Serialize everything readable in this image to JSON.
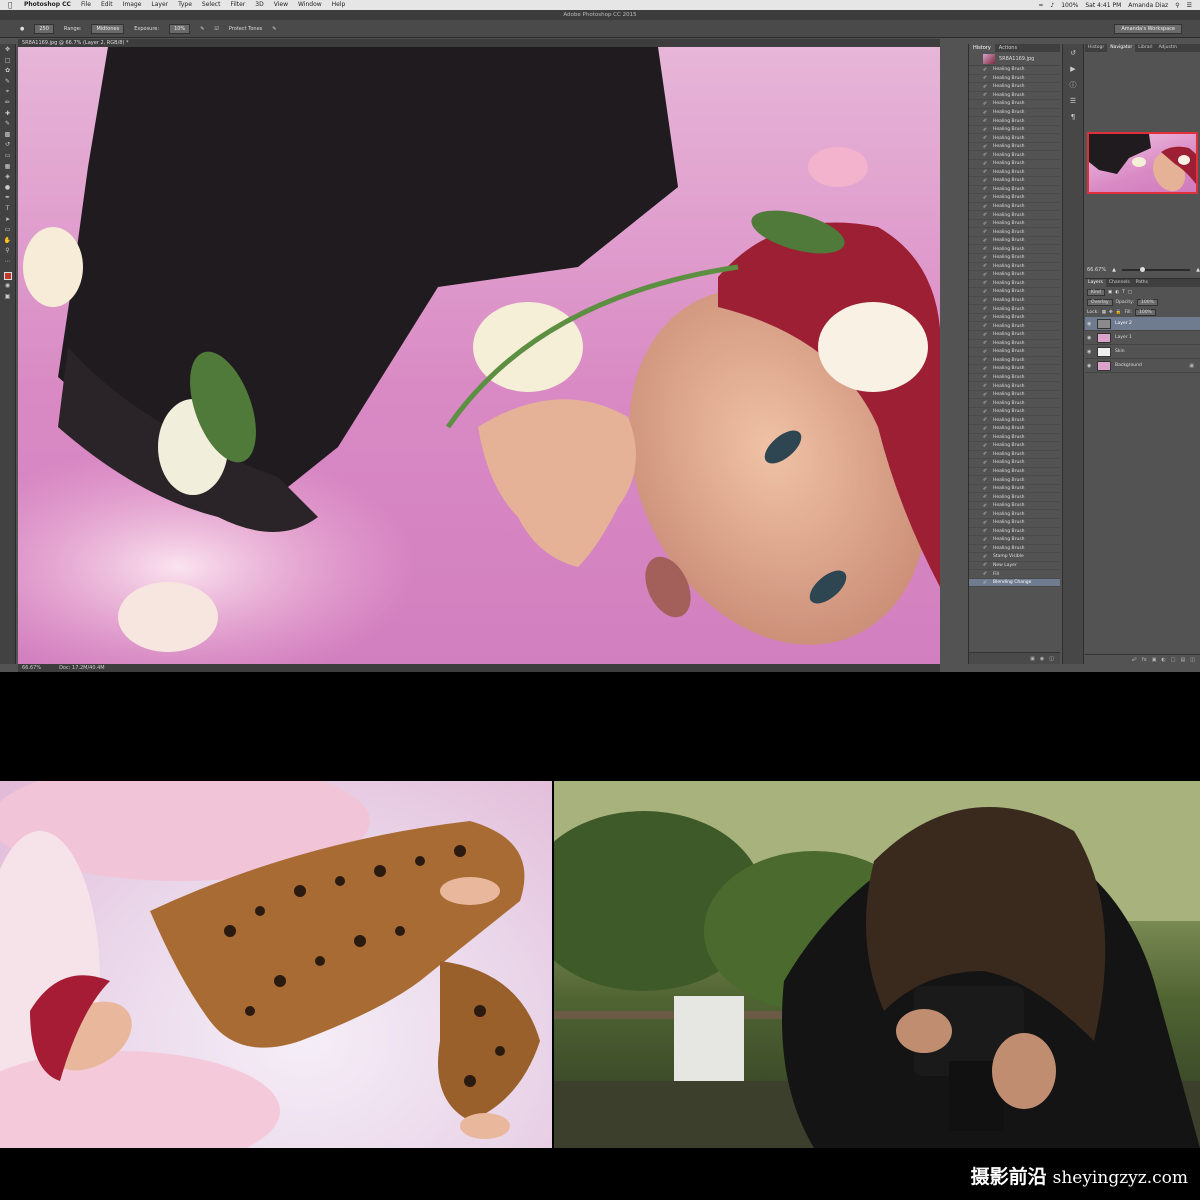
{
  "menubar": {
    "app": "Photoshop CC",
    "items": [
      "File",
      "Edit",
      "Image",
      "Layer",
      "Type",
      "Select",
      "Filter",
      "3D",
      "View",
      "Window",
      "Help"
    ],
    "battery": "100%",
    "clock": "Sat 4:41 PM",
    "user": "Amanda Diaz"
  },
  "window": {
    "title": "Adobe Photoshop CC 2015"
  },
  "options_bar": {
    "range_label": "Range:",
    "range_value": "Midtones",
    "exposure_label": "Exposure:",
    "exposure_value": "10%",
    "protect_tones": "Protect Tones",
    "workspace": "Amanda's Workspace"
  },
  "document": {
    "tab": "5R8A1169.jpg @ 66.7% (Layer 2, RGB/8) *",
    "zoom": "66.67%",
    "doc_size": "Doc: 17.2M/40.4M"
  },
  "history_panel": {
    "tabs": [
      "History",
      "Actions"
    ],
    "snapshot": "5R8A1169.jpg",
    "items": [
      "Healing Brush",
      "Healing Brush",
      "Healing Brush",
      "Healing Brush",
      "Healing Brush",
      "Healing Brush",
      "Healing Brush",
      "Healing Brush",
      "Healing Brush",
      "Healing Brush",
      "Healing Brush",
      "Healing Brush",
      "Healing Brush",
      "Healing Brush",
      "Healing Brush",
      "Healing Brush",
      "Healing Brush",
      "Healing Brush",
      "Healing Brush",
      "Healing Brush",
      "Healing Brush",
      "Healing Brush",
      "Healing Brush",
      "Healing Brush",
      "Healing Brush",
      "Healing Brush",
      "Healing Brush",
      "Healing Brush",
      "Healing Brush",
      "Healing Brush",
      "Healing Brush",
      "Healing Brush",
      "Healing Brush",
      "Healing Brush",
      "Healing Brush",
      "Healing Brush",
      "Healing Brush",
      "Healing Brush",
      "Healing Brush",
      "Healing Brush",
      "Healing Brush",
      "Healing Brush",
      "Healing Brush",
      "Healing Brush",
      "Healing Brush",
      "Healing Brush",
      "Healing Brush",
      "Healing Brush",
      "Healing Brush",
      "Healing Brush",
      "Healing Brush",
      "Healing Brush",
      "Healing Brush",
      "Healing Brush",
      "Healing Brush",
      "Healing Brush",
      "Healing Brush",
      "Stamp Visible",
      "New Layer",
      "Fill",
      "Blending Change"
    ],
    "active_index": 60
  },
  "navigator_panel": {
    "tabs": [
      "Histogr",
      "Navigator",
      "Librari",
      "Adjustm"
    ],
    "zoom": "66.67%"
  },
  "layers_panel": {
    "tabs": [
      "Layers",
      "Channels",
      "Paths"
    ],
    "kind": "Kind",
    "blend_mode": "Overlay",
    "opacity_label": "Opacity:",
    "opacity_value": "100%",
    "lock_label": "Lock:",
    "fill_label": "Fill:",
    "fill_value": "100%",
    "layers": [
      {
        "name": "Layer 2",
        "thumb": "gray",
        "active": true
      },
      {
        "name": "Layer 1",
        "thumb": "photo",
        "active": false
      },
      {
        "name": "Skin",
        "thumb": "white",
        "active": false
      },
      {
        "name": "Background",
        "thumb": "photo",
        "active": false,
        "locked": true
      }
    ]
  },
  "watermark": {
    "cn": "摄影前沿",
    "en": "sheyingzyz.com"
  },
  "colors": {
    "accent_red": "#e0303c",
    "panel_gray": "#535353",
    "canvas_pink": "#d98ac4"
  }
}
